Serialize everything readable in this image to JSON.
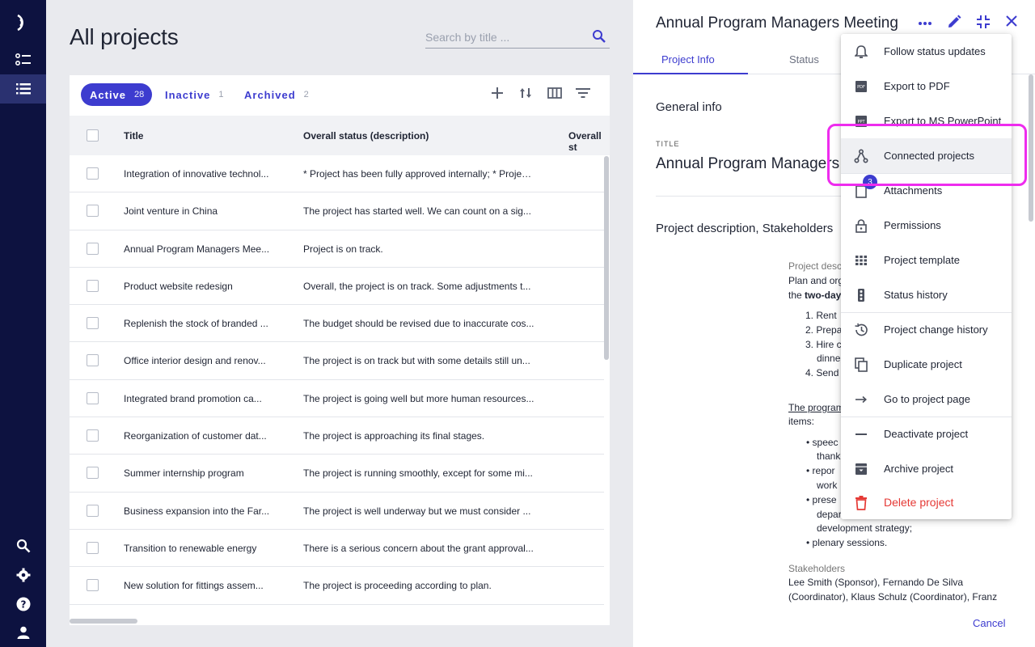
{
  "page": {
    "title": "All projects",
    "search_placeholder": "Search by title ..."
  },
  "tabs": [
    {
      "label": "Active",
      "count": "28"
    },
    {
      "label": "Inactive",
      "count": "1"
    },
    {
      "label": "Archived",
      "count": "2"
    }
  ],
  "table": {
    "columns": [
      "Title",
      "Overall status (description)",
      "Overall st"
    ],
    "rows": [
      {
        "title": "Integration of innovative technol...",
        "status": "* Project has been fully approved internally; * Projec..."
      },
      {
        "title": "Joint venture in China",
        "status": "The project has started well. We can count on a sig..."
      },
      {
        "title": "Annual Program Managers Mee...",
        "status": "Project is on track."
      },
      {
        "title": "Product website redesign",
        "status": "Overall, the project is on track. Some adjustments t..."
      },
      {
        "title": "Replenish the stock of branded ...",
        "status": "The budget should be revised due to inaccurate cos..."
      },
      {
        "title": "Office interior design and renov...",
        "status": "The project is on track but with some details still un..."
      },
      {
        "title": "Integrated brand promotion ca...",
        "status": "The project is going well but more human resources..."
      },
      {
        "title": "Reorganization of customer dat...",
        "status": "The project is approaching its final stages."
      },
      {
        "title": "Summer internship program",
        "status": "The project is running smoothly, except for some mi..."
      },
      {
        "title": "Business expansion into the Far...",
        "status": "The project is well underway but we must consider ..."
      },
      {
        "title": "Transition to renewable energy",
        "status": "There is a serious concern about the grant approval..."
      },
      {
        "title": "New solution for fittings assem...",
        "status": "The project is proceeding according to plan."
      }
    ]
  },
  "detail": {
    "title": "Annual Program Managers Meeting",
    "tabs": [
      "Project Info",
      "Status"
    ],
    "general_info": "General info",
    "title_label": "TITLE",
    "title_value": "Annual Program Managers M",
    "desc_section": "Project description, Stakeholders",
    "body": {
      "desc_label": "Project desc",
      "line1": "Plan and org",
      "line2_pre": "the ",
      "line2_bold": "two-day",
      "list1": [
        "1. Rent",
        "2. Prepa",
        "3. Hire c",
        "dinne",
        "4. Send"
      ],
      "program_link": "The program",
      "items_label": "items:",
      "bullets": [
        "• speec",
        "thank",
        "• repor",
        "work",
        "• prese",
        "depar",
        "development strategy;",
        "• plenary sessions."
      ],
      "stakeholders_label": "Stakeholders",
      "stakeholders_1": "Lee Smith (Sponsor), Fernando De Silva",
      "stakeholders_2": "(Coordinator), Klaus Schulz (Coordinator), Franz"
    },
    "cancel": "Cancel"
  },
  "menu": {
    "items": [
      {
        "label": "Follow status updates",
        "icon": "bell-icon"
      },
      {
        "label": "Export to PDF",
        "icon": "pdf-icon"
      },
      {
        "label": "Export to MS PowerPoint",
        "icon": "ppt-icon"
      },
      {
        "label": "Connected projects",
        "icon": "connected-icon"
      },
      {
        "label": "Attachments",
        "icon": "attachment-icon"
      },
      {
        "label": "Permissions",
        "icon": "lock-icon"
      },
      {
        "label": "Project template",
        "icon": "grid-icon"
      },
      {
        "label": "Status history",
        "icon": "traffic-light-icon"
      },
      {
        "label": "Project change history",
        "icon": "history-icon"
      },
      {
        "label": "Duplicate project",
        "icon": "copy-icon"
      },
      {
        "label": "Go to project page",
        "icon": "arrow-right-icon"
      },
      {
        "label": "Deactivate project",
        "icon": "minus-icon"
      },
      {
        "label": "Archive project",
        "icon": "archive-icon"
      },
      {
        "label": "Delete project",
        "icon": "trash-icon"
      }
    ],
    "attachments_badge": "3"
  },
  "colors": {
    "nav_bg": "#0d1240",
    "accent": "#3d3ccf",
    "danger": "#e53935",
    "highlight": "#ee2cee"
  }
}
